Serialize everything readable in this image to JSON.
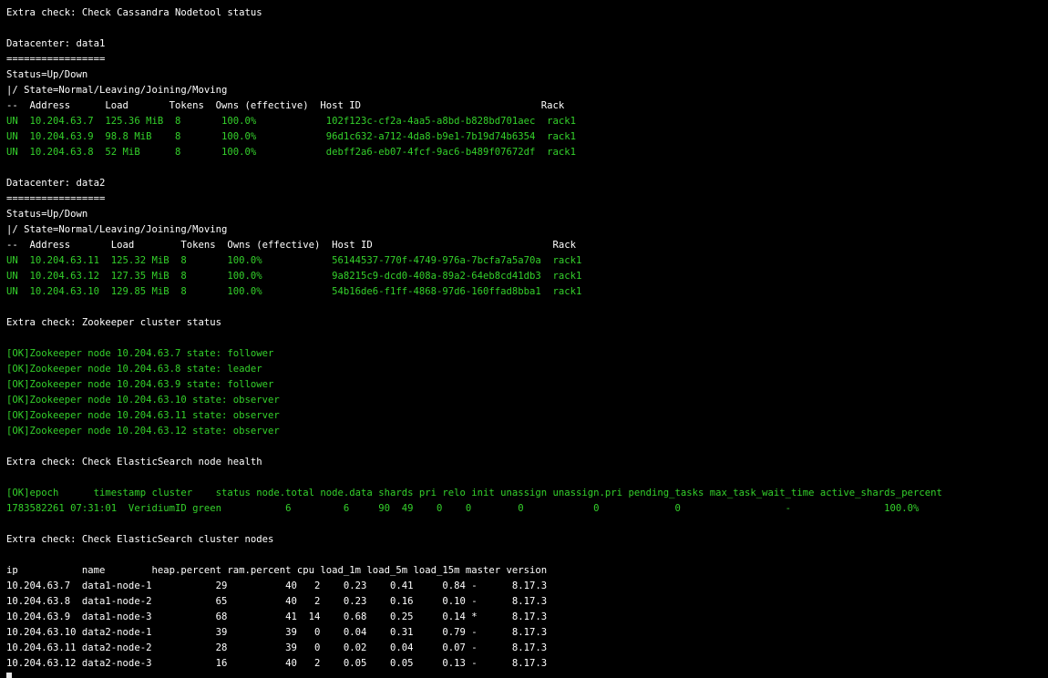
{
  "terminal": {
    "colors": {
      "background": "#000000",
      "text": "#ffffff",
      "ok_green": "#34d12b",
      "cursor": "#e6e6e6"
    },
    "lines": [
      {
        "text": "Extra check: Check Cassandra Nodetool status",
        "color": "white"
      },
      {
        "text": "",
        "color": "white"
      },
      {
        "text": "Datacenter: data1",
        "color": "white"
      },
      {
        "text": "=================",
        "color": "white"
      },
      {
        "text": "Status=Up/Down",
        "color": "white"
      },
      {
        "text": "|/ State=Normal/Leaving/Joining/Moving",
        "color": "white"
      },
      {
        "text": "--  Address      Load       Tokens  Owns (effective)  Host ID                               Rack",
        "color": "white"
      },
      {
        "text": "UN  10.204.63.7  125.36 MiB  8       100.0%            102f123c-cf2a-4aa5-a8bd-b828bd701aec  rack1",
        "color": "green"
      },
      {
        "text": "UN  10.204.63.9  98.8 MiB    8       100.0%            96d1c632-a712-4da8-b9e1-7b19d74b6354  rack1",
        "color": "green"
      },
      {
        "text": "UN  10.204.63.8  52 MiB      8       100.0%            debff2a6-eb07-4fcf-9ac6-b489f07672df  rack1",
        "color": "green"
      },
      {
        "text": "",
        "color": "white"
      },
      {
        "text": "Datacenter: data2",
        "color": "white"
      },
      {
        "text": "=================",
        "color": "white"
      },
      {
        "text": "Status=Up/Down",
        "color": "white"
      },
      {
        "text": "|/ State=Normal/Leaving/Joining/Moving",
        "color": "white"
      },
      {
        "text": "--  Address       Load        Tokens  Owns (effective)  Host ID                               Rack",
        "color": "white"
      },
      {
        "text": "UN  10.204.63.11  125.32 MiB  8       100.0%            56144537-770f-4749-976a-7bcfa7a5a70a  rack1",
        "color": "green"
      },
      {
        "text": "UN  10.204.63.12  127.35 MiB  8       100.0%            9a8215c9-dcd0-408a-89a2-64eb8cd41db3  rack1",
        "color": "green"
      },
      {
        "text": "UN  10.204.63.10  129.85 MiB  8       100.0%            54b16de6-f1ff-4868-97d6-160ffad8bba1  rack1",
        "color": "green"
      },
      {
        "text": "",
        "color": "white"
      },
      {
        "text": "Extra check: Zookeeper cluster status",
        "color": "white"
      },
      {
        "text": "",
        "color": "white"
      },
      {
        "text": "[OK]Zookeeper node 10.204.63.7 state: follower",
        "color": "green"
      },
      {
        "text": "[OK]Zookeeper node 10.204.63.8 state: leader",
        "color": "green"
      },
      {
        "text": "[OK]Zookeeper node 10.204.63.9 state: follower",
        "color": "green"
      },
      {
        "text": "[OK]Zookeeper node 10.204.63.10 state: observer",
        "color": "green"
      },
      {
        "text": "[OK]Zookeeper node 10.204.63.11 state: observer",
        "color": "green"
      },
      {
        "text": "[OK]Zookeeper node 10.204.63.12 state: observer",
        "color": "green"
      },
      {
        "text": "",
        "color": "white"
      },
      {
        "text": "Extra check: Check ElasticSearch node health",
        "color": "white"
      },
      {
        "text": "",
        "color": "white"
      },
      {
        "text": "[OK]epoch      timestamp cluster    status node.total node.data shards pri relo init unassign unassign.pri pending_tasks max_task_wait_time active_shards_percent",
        "color": "green"
      },
      {
        "text": "1783582261 07:31:01  VeridiumID green           6         6     90  49    0    0        0            0             0                  -                100.0%",
        "color": "green"
      },
      {
        "text": "",
        "color": "white"
      },
      {
        "text": "Extra check: Check ElasticSearch cluster nodes",
        "color": "white"
      },
      {
        "text": "",
        "color": "white"
      },
      {
        "text": "ip           name        heap.percent ram.percent cpu load_1m load_5m load_15m master version",
        "color": "white"
      },
      {
        "text": "10.204.63.7  data1-node-1           29          40   2    0.23    0.41     0.84 -      8.17.3",
        "color": "white"
      },
      {
        "text": "10.204.63.8  data1-node-2           65          40   2    0.23    0.16     0.10 -      8.17.3",
        "color": "white"
      },
      {
        "text": "10.204.63.9  data1-node-3           68          41  14    0.68    0.25     0.14 *      8.17.3",
        "color": "white"
      },
      {
        "text": "10.204.63.10 data2-node-1           39          39   0    0.04    0.31     0.79 -      8.17.3",
        "color": "white"
      },
      {
        "text": "10.204.63.11 data2-node-2           28          39   0    0.02    0.04     0.07 -      8.17.3",
        "color": "white"
      },
      {
        "text": "10.204.63.12 data2-node-3           16          40   2    0.05    0.05     0.13 -      8.17.3",
        "color": "white"
      }
    ]
  }
}
